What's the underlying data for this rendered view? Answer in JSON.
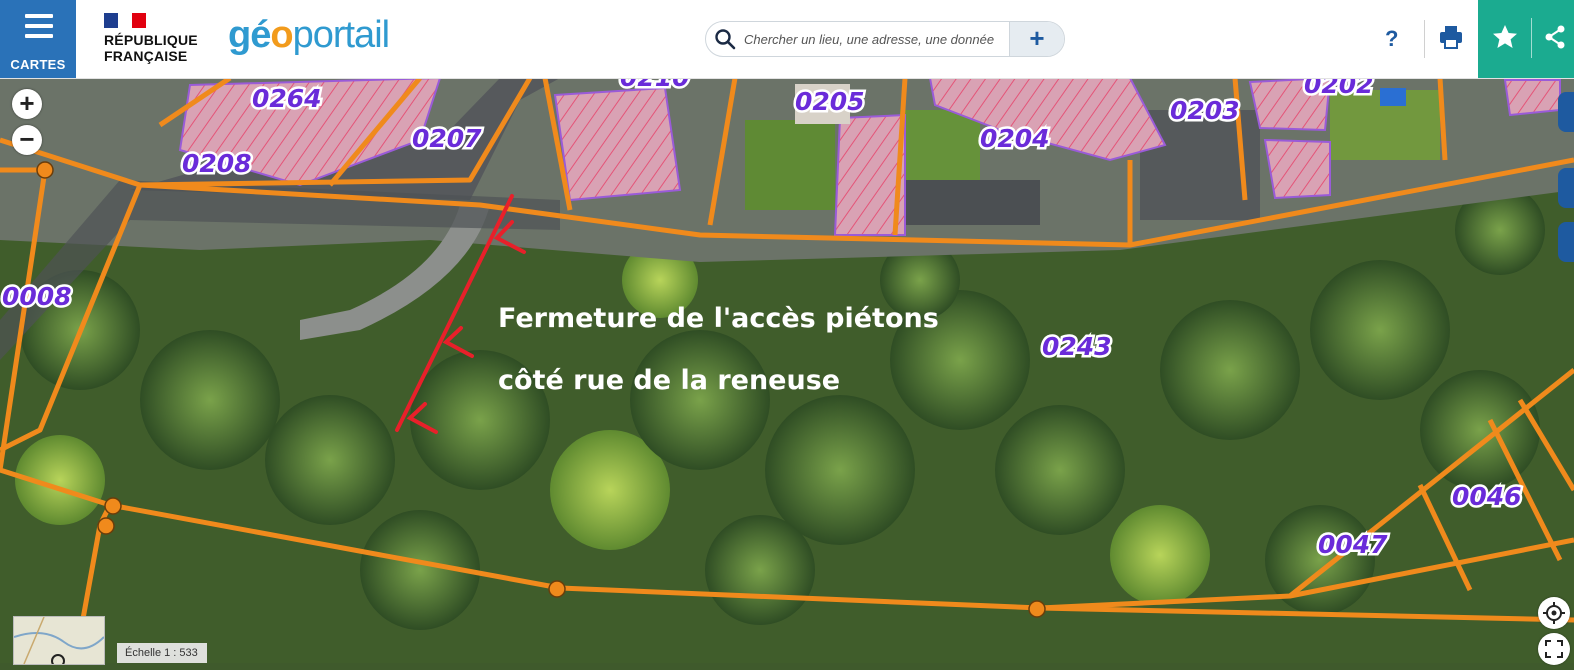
{
  "menu": {
    "label": "CARTES"
  },
  "republic": {
    "line1": "RÉPUBLIQUE",
    "line2": "FRANÇAISE"
  },
  "brand": {
    "part1": "gé",
    "part2": "o",
    "part3": "portail"
  },
  "search": {
    "placeholder": "Chercher un lieu, une adresse, une donnée",
    "value": ""
  },
  "toolbar": {
    "help_label": "?"
  },
  "zoom": {
    "in_label": "+",
    "out_label": "−"
  },
  "annotation": {
    "line1": "Fermeture de l'accès  piétons",
    "line2": "côté rue de la reneuse"
  },
  "parcels": [
    "0264",
    "0207",
    "0208",
    "0210",
    "0205",
    "0204",
    "0203",
    "0202",
    "0008",
    "0243",
    "0046",
    "0047"
  ],
  "scale": {
    "label": "Échelle 1 : 533"
  },
  "colors": {
    "cartes_blue": "#2a72b8",
    "favorites_green": "#1bab90",
    "parcel_line": "#f08a1c",
    "parcel_label": "#6a2bd9",
    "annotation_red": "#e8202a"
  }
}
